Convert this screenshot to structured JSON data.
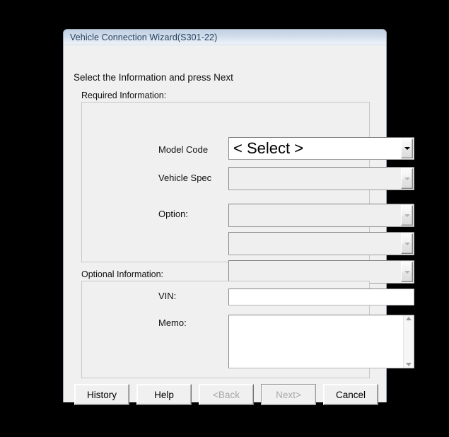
{
  "window": {
    "title": "Vehicle Connection Wizard(S301-22)",
    "instruction": "Select the Information and press Next"
  },
  "required_group": {
    "caption": "Required Information:",
    "fields": [
      {
        "label": "Model Code",
        "value": "< Select >",
        "enabled": true,
        "arrow_icon": "chevron-down-icon"
      },
      {
        "label": "Vehicle Spec",
        "value": "",
        "enabled": false,
        "arrow_icon": "chevron-down-icon"
      },
      {
        "label": "Option:",
        "value": "",
        "enabled": false,
        "arrow_icon": "chevron-down-icon"
      },
      {
        "label": "",
        "value": "",
        "enabled": false,
        "arrow_icon": "chevron-down-icon"
      },
      {
        "label": "",
        "value": "",
        "enabled": false,
        "arrow_icon": "chevron-down-icon"
      }
    ]
  },
  "optional_group": {
    "caption": "Optional Information:",
    "vin": {
      "label": "VIN:",
      "value": "",
      "placeholder": ""
    },
    "memo": {
      "label": "Memo:",
      "value": "",
      "placeholder": "",
      "scroll_up_icon": "scroll-up-arrow-icon",
      "scroll_down_icon": "scroll-down-arrow-icon"
    }
  },
  "buttons": [
    {
      "label": "History",
      "enabled": true,
      "default": false
    },
    {
      "label": "Help",
      "enabled": true,
      "default": false
    },
    {
      "label": "<Back",
      "enabled": false,
      "default": false
    },
    {
      "label": "Next>",
      "enabled": false,
      "default": true
    },
    {
      "label": "Cancel",
      "enabled": true,
      "default": false
    }
  ],
  "colors": {
    "desktop_background": "#000000",
    "dialog_background": "#f0f0f0",
    "title_bar_top": "#c3d2e3",
    "title_bar_bottom": "#edf2f8",
    "title_text": "#25405e",
    "group_border": "#c8c8c8",
    "disabled_text": "#a6a6a6"
  }
}
